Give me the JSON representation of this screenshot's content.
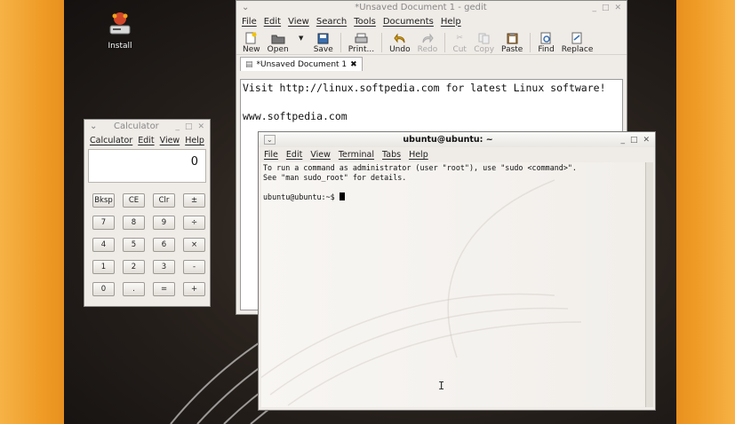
{
  "desktop": {
    "install_label": "Install"
  },
  "gedit": {
    "title": "*Unsaved Document 1 - gedit",
    "menu": [
      "File",
      "Edit",
      "View",
      "Search",
      "Tools",
      "Documents",
      "Help"
    ],
    "toolbar": [
      {
        "label": "New",
        "icon": "new-document-icon",
        "enabled": true
      },
      {
        "label": "Open",
        "icon": "folder-open-icon",
        "enabled": true
      },
      {
        "label": "Save",
        "icon": "save-icon",
        "enabled": true
      },
      {
        "label": "Print...",
        "icon": "printer-icon",
        "enabled": true
      },
      {
        "label": "Undo",
        "icon": "undo-icon",
        "enabled": true
      },
      {
        "label": "Redo",
        "icon": "redo-icon",
        "enabled": false
      },
      {
        "label": "Cut",
        "icon": "scissors-icon",
        "enabled": false
      },
      {
        "label": "Copy",
        "icon": "copy-icon",
        "enabled": false
      },
      {
        "label": "Paste",
        "icon": "paste-icon",
        "enabled": true
      },
      {
        "label": "Find",
        "icon": "find-icon",
        "enabled": true
      },
      {
        "label": "Replace",
        "icon": "replace-icon",
        "enabled": true
      }
    ],
    "tab_label": "*Unsaved Document 1",
    "lines": [
      "Visit http://linux.softpedia.com for latest Linux software!",
      "",
      "www.softpedia.com"
    ]
  },
  "calculator": {
    "title": "Calculator",
    "menu": [
      "Calculator",
      "Edit",
      "View",
      "Help"
    ],
    "display": "0",
    "keys": [
      "Bksp",
      "CE",
      "Clr",
      "±",
      "7",
      "8",
      "9",
      "÷",
      "4",
      "5",
      "6",
      "×",
      "1",
      "2",
      "3",
      "-",
      "0",
      ".",
      "=",
      "+"
    ]
  },
  "terminal": {
    "title": "ubuntu@ubuntu: ~",
    "menu": [
      "File",
      "Edit",
      "View",
      "Terminal",
      "Tabs",
      "Help"
    ],
    "lines": [
      "To run a command as administrator (user \"root\"), use \"sudo <command>\".",
      "See \"man sudo_root\" for details.",
      "",
      "ubuntu@ubuntu:~$ "
    ]
  },
  "colors": {
    "frame": "#ee9a24",
    "window_bg": "#efebe7"
  }
}
